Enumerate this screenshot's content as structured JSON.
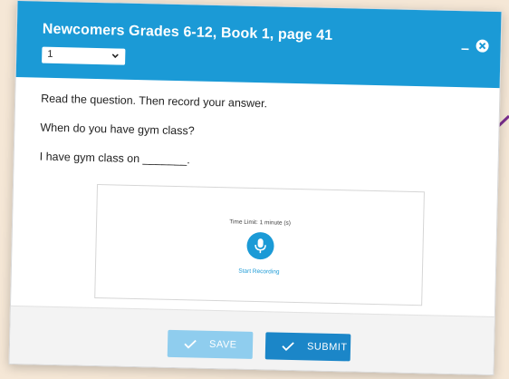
{
  "header": {
    "title": "Newcomers Grades 6-12, Book 1, page 41",
    "select_value": "1"
  },
  "prompt": {
    "instruction": "Read the question. Then record your answer.",
    "question": "When do you have gym class?",
    "answer_frame": "I have gym class on _______."
  },
  "recorder": {
    "time_limit": "Time Limit: 1 minute (s)",
    "start_label": "Start Recording"
  },
  "footer": {
    "save_label": "SAVE",
    "submit_label": "SUBMIT"
  },
  "colors": {
    "header_bg": "#1b9ad6",
    "accent": "#1b86c8",
    "save_disabled": "#8fcdee",
    "pointer": "#7a2d8e",
    "background": "#f5e7d6"
  },
  "icons": [
    "chevron-down-icon",
    "minimize-icon",
    "close-icon",
    "microphone-icon",
    "checkmark-icon"
  ]
}
